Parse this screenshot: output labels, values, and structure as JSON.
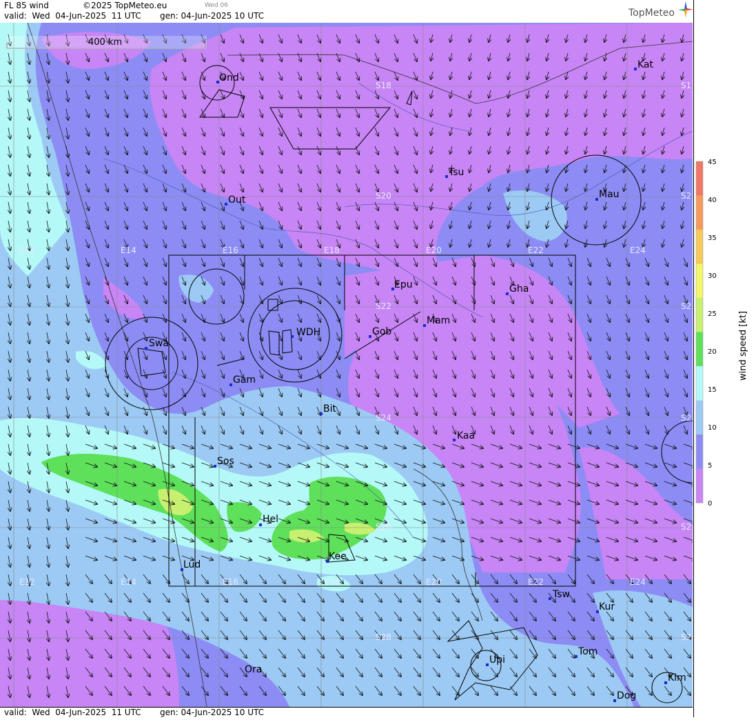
{
  "header": {
    "layer": "FL 85 wind",
    "copyright": "©2025 TopMeteo.eu",
    "day_small": "Wed 06",
    "valid": "valid:  Wed  04-Jun-2025  11 UTC",
    "gen": "gen: 04-Jun-2025 10 UTC",
    "brand": "TopMeteo"
  },
  "footer": {
    "valid": "valid:  Wed  04-Jun-2025  11 UTC",
    "gen": "gen: 04-Jun-2025 10 UTC"
  },
  "scale": {
    "label": "400 km"
  },
  "legend": {
    "title": "wind speed [kt]",
    "ticks": [
      "45",
      "40",
      "35",
      "30",
      "25",
      "20",
      "15",
      "10",
      "5",
      "0"
    ],
    "colors": [
      "#ee7766",
      "#f49a5c",
      "#f7c95a",
      "#f3f56a",
      "#c8f070",
      "#5ee05a",
      "#b4f8f8",
      "#9ccaf4",
      "#8c8cf4",
      "#c785f5"
    ]
  },
  "places": [
    {
      "name": "Ond"
    },
    {
      "name": "Kat"
    },
    {
      "name": "Tsu"
    },
    {
      "name": "Mau"
    },
    {
      "name": "Out"
    },
    {
      "name": "Epu"
    },
    {
      "name": "Gha"
    },
    {
      "name": "Mam"
    },
    {
      "name": "Gob"
    },
    {
      "name": "WDH"
    },
    {
      "name": "Swa"
    },
    {
      "name": "Gam"
    },
    {
      "name": "Bit"
    },
    {
      "name": "Kaa"
    },
    {
      "name": "Sos"
    },
    {
      "name": "Hel"
    },
    {
      "name": "Kee"
    },
    {
      "name": "Lud"
    },
    {
      "name": "Tsw"
    },
    {
      "name": "Kur"
    },
    {
      "name": "Tom"
    },
    {
      "name": "Upi"
    },
    {
      "name": "Ora"
    },
    {
      "name": "Kim"
    },
    {
      "name": "Dog"
    }
  ],
  "grid_labels": {
    "lat": [
      "S18",
      "S20",
      "S22",
      "S24",
      "S26",
      "S28"
    ],
    "lon": [
      "E12",
      "E14",
      "E16",
      "E18",
      "E20",
      "E22",
      "E24"
    ],
    "edge": [
      "S1",
      "S2",
      "S2",
      "S2",
      "S2",
      "S2"
    ]
  }
}
